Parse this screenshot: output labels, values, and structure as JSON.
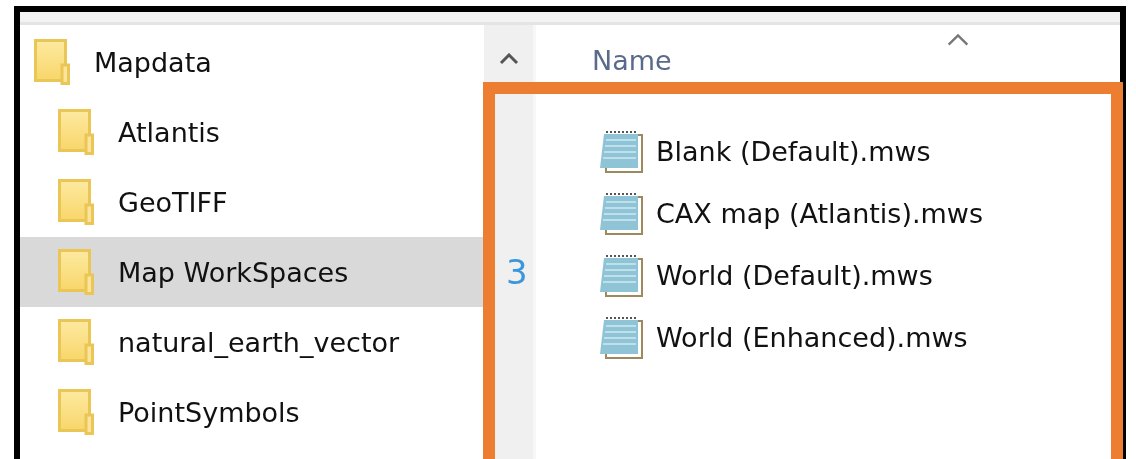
{
  "nav_tree": [
    {
      "label": "Mapdata",
      "selected": false,
      "children": [
        {
          "label": "Atlantis",
          "selected": false
        },
        {
          "label": "GeoTIFF",
          "selected": false
        },
        {
          "label": "Map WorkSpaces",
          "selected": true
        },
        {
          "label": "natural_earth_vector",
          "selected": false
        },
        {
          "label": "PointSymbols",
          "selected": false
        }
      ]
    }
  ],
  "file_list": {
    "columns": [
      {
        "label": "Name",
        "sorted": true
      }
    ],
    "rows": [
      {
        "name": "Blank (Default).mws"
      },
      {
        "name": "CAX map (Atlantis).mws"
      },
      {
        "name": "World (Default).mws"
      },
      {
        "name": "World (Enhanced).mws"
      }
    ]
  },
  "annotation": {
    "label": "3"
  }
}
